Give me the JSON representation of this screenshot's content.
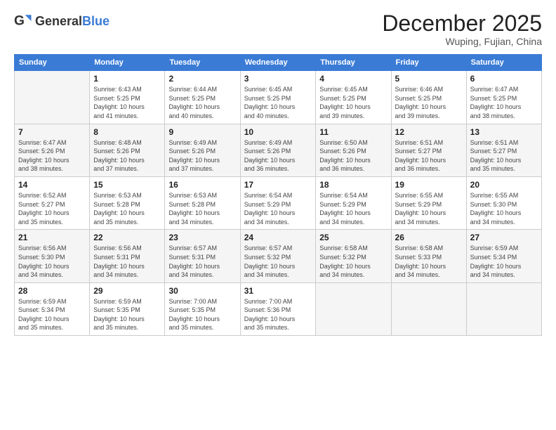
{
  "header": {
    "logo_general": "General",
    "logo_blue": "Blue",
    "month_title": "December 2025",
    "location": "Wuping, Fujian, China"
  },
  "days_of_week": [
    "Sunday",
    "Monday",
    "Tuesday",
    "Wednesday",
    "Thursday",
    "Friday",
    "Saturday"
  ],
  "weeks": [
    [
      {
        "day": "",
        "info": ""
      },
      {
        "day": "1",
        "info": "Sunrise: 6:43 AM\nSunset: 5:25 PM\nDaylight: 10 hours\nand 41 minutes."
      },
      {
        "day": "2",
        "info": "Sunrise: 6:44 AM\nSunset: 5:25 PM\nDaylight: 10 hours\nand 40 minutes."
      },
      {
        "day": "3",
        "info": "Sunrise: 6:45 AM\nSunset: 5:25 PM\nDaylight: 10 hours\nand 40 minutes."
      },
      {
        "day": "4",
        "info": "Sunrise: 6:45 AM\nSunset: 5:25 PM\nDaylight: 10 hours\nand 39 minutes."
      },
      {
        "day": "5",
        "info": "Sunrise: 6:46 AM\nSunset: 5:25 PM\nDaylight: 10 hours\nand 39 minutes."
      },
      {
        "day": "6",
        "info": "Sunrise: 6:47 AM\nSunset: 5:25 PM\nDaylight: 10 hours\nand 38 minutes."
      }
    ],
    [
      {
        "day": "7",
        "info": "Sunrise: 6:47 AM\nSunset: 5:26 PM\nDaylight: 10 hours\nand 38 minutes."
      },
      {
        "day": "8",
        "info": "Sunrise: 6:48 AM\nSunset: 5:26 PM\nDaylight: 10 hours\nand 37 minutes."
      },
      {
        "day": "9",
        "info": "Sunrise: 6:49 AM\nSunset: 5:26 PM\nDaylight: 10 hours\nand 37 minutes."
      },
      {
        "day": "10",
        "info": "Sunrise: 6:49 AM\nSunset: 5:26 PM\nDaylight: 10 hours\nand 36 minutes."
      },
      {
        "day": "11",
        "info": "Sunrise: 6:50 AM\nSunset: 5:26 PM\nDaylight: 10 hours\nand 36 minutes."
      },
      {
        "day": "12",
        "info": "Sunrise: 6:51 AM\nSunset: 5:27 PM\nDaylight: 10 hours\nand 36 minutes."
      },
      {
        "day": "13",
        "info": "Sunrise: 6:51 AM\nSunset: 5:27 PM\nDaylight: 10 hours\nand 35 minutes."
      }
    ],
    [
      {
        "day": "14",
        "info": "Sunrise: 6:52 AM\nSunset: 5:27 PM\nDaylight: 10 hours\nand 35 minutes."
      },
      {
        "day": "15",
        "info": "Sunrise: 6:53 AM\nSunset: 5:28 PM\nDaylight: 10 hours\nand 35 minutes."
      },
      {
        "day": "16",
        "info": "Sunrise: 6:53 AM\nSunset: 5:28 PM\nDaylight: 10 hours\nand 34 minutes."
      },
      {
        "day": "17",
        "info": "Sunrise: 6:54 AM\nSunset: 5:29 PM\nDaylight: 10 hours\nand 34 minutes."
      },
      {
        "day": "18",
        "info": "Sunrise: 6:54 AM\nSunset: 5:29 PM\nDaylight: 10 hours\nand 34 minutes."
      },
      {
        "day": "19",
        "info": "Sunrise: 6:55 AM\nSunset: 5:29 PM\nDaylight: 10 hours\nand 34 minutes."
      },
      {
        "day": "20",
        "info": "Sunrise: 6:55 AM\nSunset: 5:30 PM\nDaylight: 10 hours\nand 34 minutes."
      }
    ],
    [
      {
        "day": "21",
        "info": "Sunrise: 6:56 AM\nSunset: 5:30 PM\nDaylight: 10 hours\nand 34 minutes."
      },
      {
        "day": "22",
        "info": "Sunrise: 6:56 AM\nSunset: 5:31 PM\nDaylight: 10 hours\nand 34 minutes."
      },
      {
        "day": "23",
        "info": "Sunrise: 6:57 AM\nSunset: 5:31 PM\nDaylight: 10 hours\nand 34 minutes."
      },
      {
        "day": "24",
        "info": "Sunrise: 6:57 AM\nSunset: 5:32 PM\nDaylight: 10 hours\nand 34 minutes."
      },
      {
        "day": "25",
        "info": "Sunrise: 6:58 AM\nSunset: 5:32 PM\nDaylight: 10 hours\nand 34 minutes."
      },
      {
        "day": "26",
        "info": "Sunrise: 6:58 AM\nSunset: 5:33 PM\nDaylight: 10 hours\nand 34 minutes."
      },
      {
        "day": "27",
        "info": "Sunrise: 6:59 AM\nSunset: 5:34 PM\nDaylight: 10 hours\nand 34 minutes."
      }
    ],
    [
      {
        "day": "28",
        "info": "Sunrise: 6:59 AM\nSunset: 5:34 PM\nDaylight: 10 hours\nand 35 minutes."
      },
      {
        "day": "29",
        "info": "Sunrise: 6:59 AM\nSunset: 5:35 PM\nDaylight: 10 hours\nand 35 minutes."
      },
      {
        "day": "30",
        "info": "Sunrise: 7:00 AM\nSunset: 5:35 PM\nDaylight: 10 hours\nand 35 minutes."
      },
      {
        "day": "31",
        "info": "Sunrise: 7:00 AM\nSunset: 5:36 PM\nDaylight: 10 hours\nand 35 minutes."
      },
      {
        "day": "",
        "info": ""
      },
      {
        "day": "",
        "info": ""
      },
      {
        "day": "",
        "info": ""
      }
    ]
  ]
}
